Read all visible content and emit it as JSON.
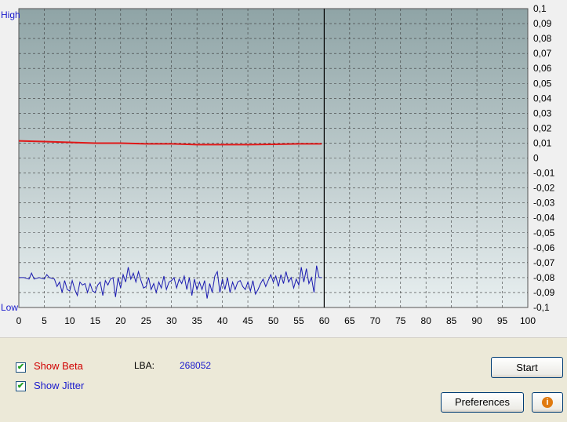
{
  "chart": {
    "high_label": "High",
    "low_label": "Low",
    "colors": {
      "beta": "#e01818",
      "jitter": "#1a1ab0",
      "plot_bg_top": "#8fa4a6",
      "plot_bg_bottom": "#e8eff0",
      "gridline": "#3a3a3a"
    }
  },
  "chart_data": {
    "type": "line",
    "x_ticks": [
      "0",
      "5",
      "10",
      "15",
      "20",
      "25",
      "30",
      "35",
      "40",
      "45",
      "50",
      "55",
      "60",
      "65",
      "70",
      "75",
      "80",
      "85",
      "90",
      "95",
      "100"
    ],
    "y_ticks": [
      "0,1",
      "0,09",
      "0,08",
      "0,07",
      "0,06",
      "0,05",
      "0,04",
      "0,03",
      "0,02",
      "0,01",
      "0",
      "-0,01",
      "-0,02",
      "-0,03",
      "-0,04",
      "-0,05",
      "-0,06",
      "-0,07",
      "-0,08",
      "-0,09",
      "-0,1"
    ],
    "xlim": [
      0,
      100
    ],
    "ylim": [
      -0.1,
      0.1
    ],
    "progress_marker_x": 60,
    "grid": true,
    "series": [
      {
        "name": "Beta",
        "x": [
          0,
          5,
          10,
          15,
          20,
          25,
          30,
          35,
          40,
          45,
          50,
          55,
          59.5
        ],
        "values": [
          0.0115,
          0.011,
          0.0105,
          0.01,
          0.01,
          0.0095,
          0.0095,
          0.009,
          0.009,
          0.009,
          0.0092,
          0.0095,
          0.0095
        ]
      },
      {
        "name": "Jitter",
        "x": [
          0,
          1,
          2,
          2.5,
          3,
          4,
          5,
          5.5,
          6,
          7,
          7.5,
          8,
          8.5,
          9,
          9.5,
          10,
          10.5,
          11,
          11.5,
          12,
          12.5,
          13,
          13.5,
          14,
          14.5,
          15,
          15.5,
          16,
          16.5,
          17,
          17.5,
          18,
          18.5,
          19,
          19.5,
          20,
          20.5,
          21,
          21.5,
          22,
          22.5,
          23,
          23.5,
          24,
          24.5,
          25,
          25.5,
          26,
          26.5,
          27,
          27.5,
          28,
          28.5,
          29,
          29.5,
          30,
          30.5,
          31,
          31.5,
          32,
          32.5,
          33,
          33.5,
          34,
          34.5,
          35,
          35.5,
          36,
          36.5,
          37,
          37.5,
          38,
          38.5,
          39,
          39.5,
          40,
          40.5,
          41,
          41.5,
          42,
          42.5,
          43,
          43.5,
          44,
          44.5,
          45,
          45.5,
          46,
          46.5,
          47,
          47.5,
          48,
          48.5,
          49,
          49.5,
          50,
          50.5,
          51,
          51.5,
          52,
          52.5,
          53,
          53.5,
          54,
          54.5,
          55,
          55.5,
          56,
          56.5,
          57,
          57.5,
          58,
          58.5,
          59,
          59.5
        ],
        "values": [
          -0.08,
          -0.08,
          -0.081,
          -0.077,
          -0.081,
          -0.08,
          -0.081,
          -0.078,
          -0.08,
          -0.081,
          -0.086,
          -0.083,
          -0.09,
          -0.082,
          -0.088,
          -0.089,
          -0.082,
          -0.088,
          -0.092,
          -0.083,
          -0.085,
          -0.084,
          -0.09,
          -0.084,
          -0.089,
          -0.09,
          -0.085,
          -0.083,
          -0.092,
          -0.082,
          -0.085,
          -0.081,
          -0.08,
          -0.093,
          -0.08,
          -0.087,
          -0.078,
          -0.083,
          -0.073,
          -0.081,
          -0.077,
          -0.083,
          -0.076,
          -0.082,
          -0.087,
          -0.086,
          -0.08,
          -0.088,
          -0.084,
          -0.09,
          -0.083,
          -0.087,
          -0.079,
          -0.088,
          -0.083,
          -0.082,
          -0.08,
          -0.087,
          -0.081,
          -0.084,
          -0.079,
          -0.088,
          -0.08,
          -0.092,
          -0.081,
          -0.088,
          -0.083,
          -0.088,
          -0.082,
          -0.094,
          -0.084,
          -0.09,
          -0.079,
          -0.076,
          -0.09,
          -0.081,
          -0.088,
          -0.08,
          -0.09,
          -0.083,
          -0.088,
          -0.083,
          -0.082,
          -0.086,
          -0.088,
          -0.083,
          -0.089,
          -0.082,
          -0.091,
          -0.088,
          -0.084,
          -0.081,
          -0.086,
          -0.082,
          -0.078,
          -0.083,
          -0.079,
          -0.086,
          -0.078,
          -0.084,
          -0.076,
          -0.083,
          -0.08,
          -0.087,
          -0.081,
          -0.085,
          -0.073,
          -0.083,
          -0.074,
          -0.084,
          -0.08,
          -0.09,
          -0.072,
          -0.08,
          -0.08
        ]
      }
    ]
  },
  "controls": {
    "show_beta": {
      "label": "Show Beta",
      "checked": true,
      "color": "#d00000"
    },
    "show_jitter": {
      "label": "Show Jitter",
      "checked": true,
      "color": "#1a1acc"
    },
    "lba_label": "LBA:",
    "lba_value": "268052",
    "start_label": "Start",
    "preferences_label": "Preferences",
    "info_glyph": "i"
  }
}
